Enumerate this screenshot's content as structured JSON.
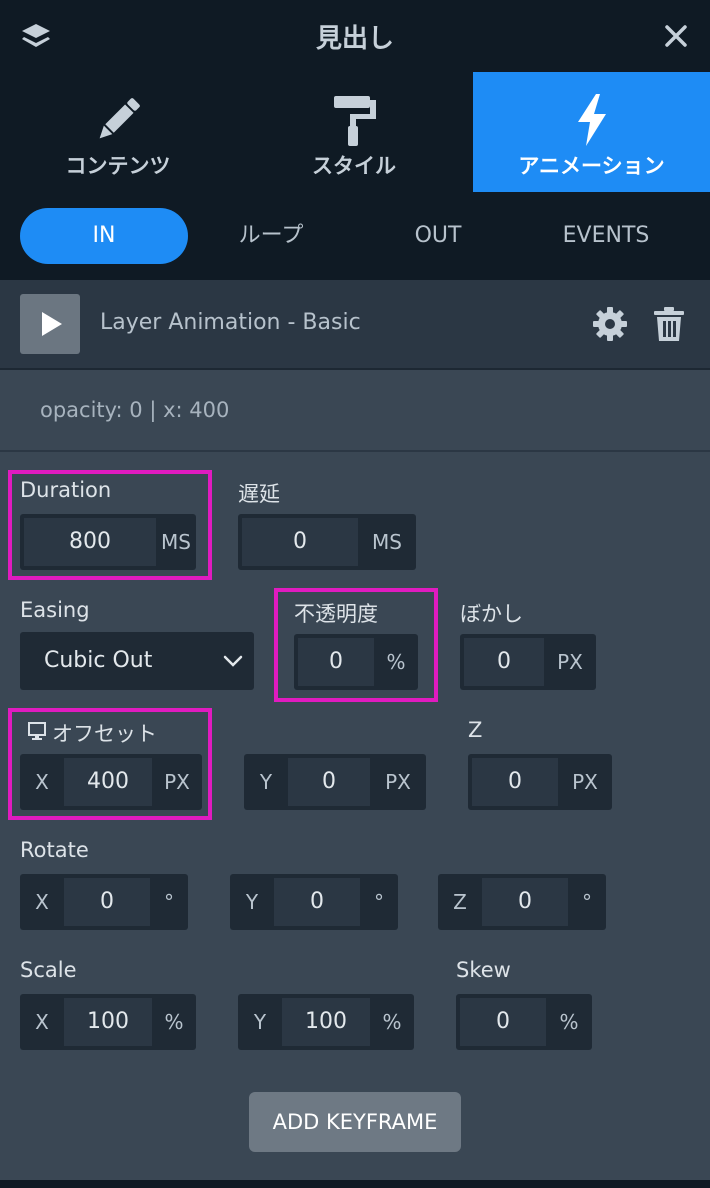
{
  "header": {
    "title": "見出し",
    "layers_icon": "layers-icon",
    "close_icon": "close-icon"
  },
  "tabs": [
    {
      "label": "コンテンツ",
      "icon": "pencil-icon",
      "active": false
    },
    {
      "label": "スタイル",
      "icon": "paint-roller-icon",
      "active": false
    },
    {
      "label": "アニメーション",
      "icon": "lightning-icon",
      "active": true
    }
  ],
  "subtabs": [
    {
      "label": "IN",
      "active": true
    },
    {
      "label": "ループ",
      "active": false
    },
    {
      "label": "OUT",
      "active": false
    },
    {
      "label": "EVENTS",
      "active": false
    }
  ],
  "layer": {
    "name": "Layer Animation - Basic"
  },
  "summary": "opacity: 0 | x: 400",
  "fields": {
    "duration": {
      "label": "Duration",
      "value": "800",
      "unit": "MS"
    },
    "delay": {
      "label": "遅延",
      "value": "0",
      "unit": "MS"
    },
    "easing": {
      "label": "Easing",
      "value": "Cubic Out"
    },
    "opacity": {
      "label": "不透明度",
      "value": "0",
      "unit": "%"
    },
    "blur": {
      "label": "ぼかし",
      "value": "0",
      "unit": "PX"
    },
    "offset": {
      "label": "オフセット",
      "x": {
        "axis": "X",
        "value": "400",
        "unit": "PX"
      },
      "y": {
        "axis": "Y",
        "value": "0",
        "unit": "PX"
      }
    },
    "z": {
      "label": "Z",
      "value": "0",
      "unit": "PX"
    },
    "rotate": {
      "label": "Rotate",
      "x": {
        "axis": "X",
        "value": "0",
        "unit": "°"
      },
      "y": {
        "axis": "Y",
        "value": "0",
        "unit": "°"
      },
      "z": {
        "axis": "Z",
        "value": "0",
        "unit": "°"
      }
    },
    "scale": {
      "label": "Scale",
      "x": {
        "axis": "X",
        "value": "100",
        "unit": "%"
      },
      "y": {
        "axis": "Y",
        "value": "100",
        "unit": "%"
      }
    },
    "skew": {
      "label": "Skew",
      "value": "0",
      "unit": "%"
    }
  },
  "add_keyframe": "ADD KEYFRAME",
  "colors": {
    "accent": "#1e8cf5",
    "highlight": "#e01bc0",
    "background": "#0f1a24",
    "panel": "#3a4754"
  }
}
